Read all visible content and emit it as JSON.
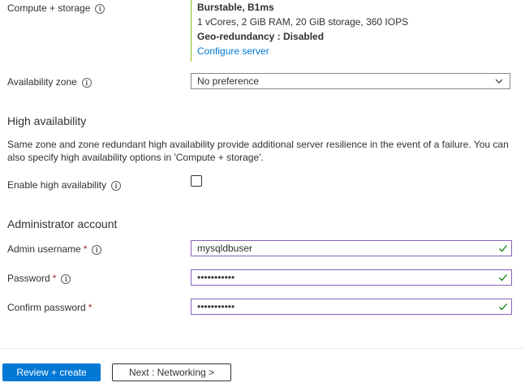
{
  "compute": {
    "label": "Compute + storage",
    "tier": "Burstable, B1ms",
    "specs": "1 vCores, 2 GiB RAM, 20 GiB storage, 360 IOPS",
    "geo": "Geo-redundancy : Disabled",
    "configure_link": "Configure server"
  },
  "availability_zone": {
    "label": "Availability zone",
    "value": "No preference"
  },
  "high_availability": {
    "title": "High availability",
    "description": "Same zone and zone redundant high availability provide additional server resilience in the event of a failure. You can also specify high availability options in 'Compute + storage'.",
    "enable_label": "Enable high availability",
    "enabled": false
  },
  "admin": {
    "title": "Administrator account",
    "username_label": "Admin username",
    "username_value": "mysqldbuser",
    "password_label": "Password",
    "password_value": "•••••••••••",
    "confirm_label": "Confirm password",
    "confirm_value": "•••••••••••",
    "required_mark": "*"
  },
  "footer": {
    "review_label": "Review + create",
    "next_label": "Next : Networking >"
  },
  "icons": {
    "info": "i",
    "info_icon": "info-icon",
    "checkmark_icon": "checkmark-icon",
    "chevron_icon": "chevron-down-icon"
  },
  "colors": {
    "accent": "#0078d4",
    "valid_border": "#8764b8",
    "valid_check": "#107c10",
    "summary_rule": "#8cbd18"
  }
}
